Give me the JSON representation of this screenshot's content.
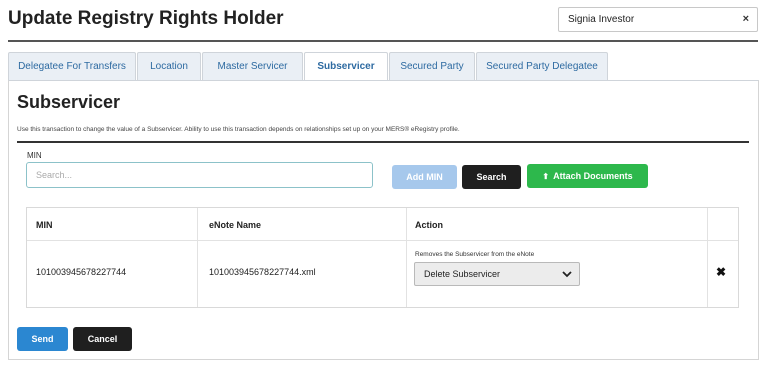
{
  "header": {
    "title": "Update Registry Rights Holder",
    "investor_value": "Signia Investor",
    "clear_icon": "×"
  },
  "tabs": [
    {
      "label": "Delegatee For Transfers",
      "active": false
    },
    {
      "label": "Location",
      "active": false
    },
    {
      "label": "Master Servicer",
      "active": false
    },
    {
      "label": "Subservicer",
      "active": true
    },
    {
      "label": "Secured Party",
      "active": false
    },
    {
      "label": "Secured Party Delegatee",
      "active": false
    }
  ],
  "section": {
    "title": "Subservicer",
    "help_text": "Use this transaction to change the value of a Subservicer. Ability to use this transaction depends on relationships set up on your MERS® eRegistry profile."
  },
  "search": {
    "label": "MIN",
    "placeholder": "Search...",
    "value": ""
  },
  "buttons": {
    "add_min": "Add MIN",
    "search": "Search",
    "attach": "Attach Documents",
    "send": "Send",
    "cancel": "Cancel"
  },
  "table": {
    "columns": [
      "MIN",
      "eNote Name",
      "Action"
    ],
    "rows": [
      {
        "min": "101003945678227744",
        "enote_name": "101003945678227744.xml",
        "action_hint": "Removes the Subservicer from the eNote",
        "action_value": "Delete Subservicer",
        "remove_icon": "✖"
      }
    ]
  },
  "colors": {
    "tab_text": "#2d6aa1",
    "add_min_disabled": "#a6c8ec",
    "attach_green": "#2db84c",
    "send_blue": "#2b87d1",
    "dark_button": "#1f1f1f"
  },
  "icons": {
    "upload": "upload-icon",
    "remove": "remove-icon",
    "chevron": "chevron-down-icon",
    "clear": "clear-icon"
  }
}
